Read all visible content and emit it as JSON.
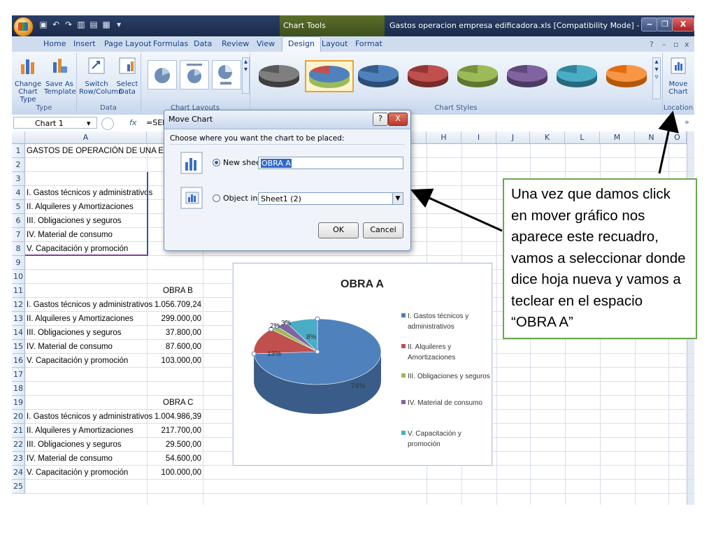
{
  "titlebar": {
    "chart_tools": "Chart Tools",
    "window_title": "Gastos operacion empresa edificadora.xls  [Compatibility Mode] - Microsoft Excel",
    "min": "‒",
    "max": "❐",
    "close": "X"
  },
  "tabs": [
    "Home",
    "Insert",
    "Page Layout",
    "Formulas",
    "Data",
    "Review",
    "View",
    "Design",
    "Layout",
    "Format"
  ],
  "active_tab": "Design",
  "ribbon": {
    "type_group": "Type",
    "data_group": "Data",
    "chart_layouts_group": "Chart Layouts",
    "chart_styles_group": "Chart Styles",
    "location_group": "Location",
    "change_chart_type": [
      "Change",
      "Chart Type"
    ],
    "save_as_template": [
      "Save As",
      "Template"
    ],
    "switch_row_column": [
      "Switch",
      "Row/Column"
    ],
    "select_data": [
      "Select",
      "Data"
    ],
    "move_chart": [
      "Move",
      "Chart"
    ]
  },
  "formula_bar": {
    "name_box": "Chart 1",
    "fx": "fx",
    "formula": "=SERI"
  },
  "columns": [
    "A",
    "H",
    "I",
    "J",
    "K",
    "L",
    "M",
    "N",
    "O"
  ],
  "rows": [
    "1",
    "2",
    "3",
    "4",
    "5",
    "6",
    "7",
    "8",
    "9",
    "10",
    "11",
    "12",
    "13",
    "14",
    "15",
    "16",
    "17",
    "18",
    "19",
    "20",
    "21",
    "22",
    "23",
    "24",
    "25"
  ],
  "cells": {
    "r1": "GASTOS DE OPERACIÓN DE UNA EMPRESA",
    "r3": "I. Gastos técnicos y administrativos",
    "r4": "II. Alquileres y Amortizaciones",
    "r5": "III. Obligaciones y seguros",
    "r6": "IV. Material de consumo",
    "r7": "V. Capacitación y promoción",
    "r10b": "OBRA B",
    "r11": "I. Gastos técnicos y administrativos",
    "r11b": "1.056.709,24",
    "r12": "II. Alquileres y Amortizaciones",
    "r12b": "299.000,00",
    "r13": "III. Obligaciones y seguros",
    "r13b": "37.800,00",
    "r14": "IV. Material de consumo",
    "r14b": "87.600,00",
    "r15": "V. Capacitación y promoción",
    "r15b": "103.000,00",
    "r18b": "OBRA C",
    "r19": "I. Gastos técnicos y administrativos",
    "r19b": "1.004.986,39",
    "r20": "II. Alquileres y Amortizaciones",
    "r20b": "217.700,00",
    "r21": "III. Obligaciones y seguros",
    "r21b": "29.500,00",
    "r22": "IV. Material de consumo",
    "r22b": "54.600,00",
    "r23": "V. Capacitación y promoción",
    "r23b": "100.000,00"
  },
  "dialog": {
    "title": "Move Chart",
    "help": "?",
    "close": "X",
    "prompt": "Choose where you want the chart to be placed:",
    "new_sheet_label": "New sheet:",
    "new_sheet_value": "OBRA A",
    "object_in_label": "Object in:",
    "object_in_value": "Sheet1 (2)",
    "ok": "OK",
    "cancel": "Cancel"
  },
  "chart_data": {
    "type": "pie",
    "title": "OBRA A",
    "categories": [
      "I. Gastos técnicos y administrativos",
      "II. Alquileres y Amortizaciones",
      "III. Obligaciones y seguros",
      "IV. Material de consumo",
      "V. Capacitación y promoción"
    ],
    "values": [
      74,
      13,
      2,
      3,
      8
    ],
    "labels": [
      "74%",
      "13%",
      "2%",
      "3%",
      "8%"
    ],
    "colors": [
      "#4f81bd",
      "#c0504d",
      "#9bbb59",
      "#8064a2",
      "#4bacc6"
    ],
    "legend_position": "right"
  },
  "annotation": "Una vez que damos click en mover gráfico nos aparece este recuadro, vamos a seleccionar donde dice hoja nueva y vamos a teclear en el espacio “OBRA A”"
}
